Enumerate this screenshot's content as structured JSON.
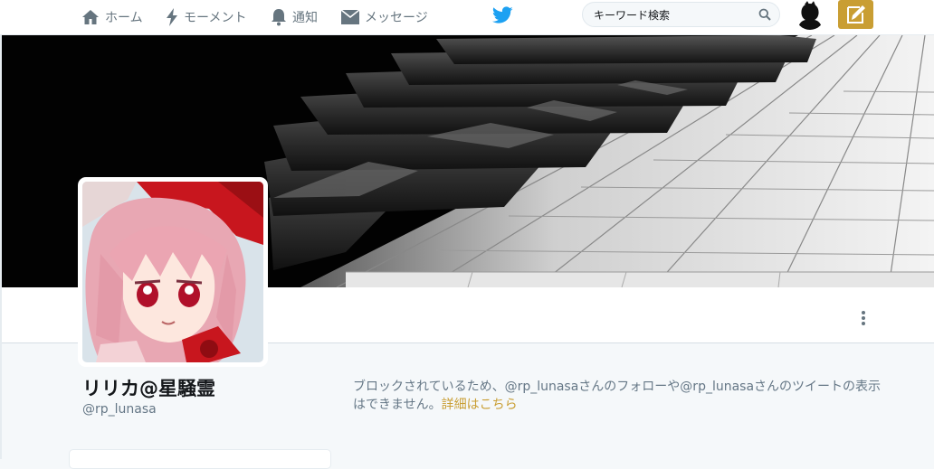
{
  "nav": {
    "home": "ホーム",
    "moments": "モーメント",
    "notifications": "通知",
    "messages": "メッセージ"
  },
  "search": {
    "placeholder": "キーワード検索"
  },
  "profile": {
    "name": "リリカ@星騒霊",
    "handle": "@rp_lunasa"
  },
  "blocked": {
    "message": "ブロックされているため、@rp_lunasaさんのフォローや@rp_lunasaさんのツイートの表示はできません。",
    "link": "詳細はこちら"
  },
  "colors": {
    "accent": "#c99e33",
    "twitter_blue": "#1da1f2",
    "nav_gray": "#66757f"
  }
}
